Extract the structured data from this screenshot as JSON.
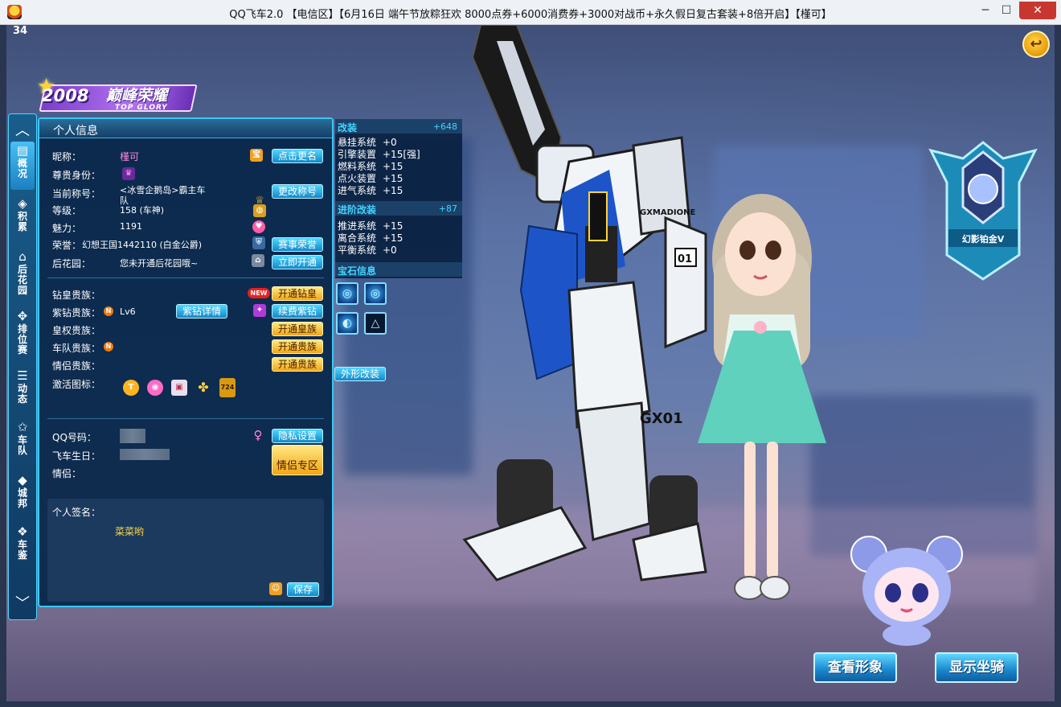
{
  "window": {
    "title": "QQ飞车2.0 【电信区】【6月16日 端午节放粽狂欢 8000点券+6000消费券+3000对战币+永久假日复古套装+8倍开启】【槿可】",
    "minimize": "─",
    "maximize": "☐",
    "close": "✕"
  },
  "hud": {
    "fps": "34",
    "back_icon": "back-arrow-icon"
  },
  "banner": {
    "year": "2008",
    "name": "巅峰荣耀",
    "sub": "TOP GLORY"
  },
  "nav": {
    "items": [
      {
        "label": "概况",
        "icon": "profile-card-icon",
        "active": true
      },
      {
        "label": "积累",
        "icon": "layers-icon",
        "active": false
      },
      {
        "label": "后花园",
        "icon": "garden-house-icon",
        "active": false
      },
      {
        "label": "排位赛",
        "icon": "ranked-wings-icon",
        "active": false
      },
      {
        "label": "动态",
        "icon": "feed-icon",
        "active": false
      },
      {
        "label": "车队",
        "icon": "team-star-icon",
        "active": false
      },
      {
        "label": "城邦",
        "icon": "city-icon",
        "active": false
      },
      {
        "label": "车鉴",
        "icon": "car-book-icon",
        "active": false
      }
    ]
  },
  "profile": {
    "panel_title": "个人信息",
    "nickname_label": "昵称：",
    "nickname": "槿可",
    "rename_button": "点击更名",
    "noble_label": "尊贵身份：",
    "title_label": "当前称号：",
    "title_value_line1": "<冰雪企鹅岛>霸主车",
    "title_value_line2": "队",
    "change_title_button": "更改称号",
    "level_label": "等级：",
    "level_value": "158 (车神)",
    "charm_label": "魅力：",
    "charm_value": "1191",
    "honor_label": "荣誉：",
    "honor_value": "幻想王国1442110 (白金公爵)",
    "honor_button": "赛事荣誉",
    "garden_label": "后花园：",
    "garden_value": "您未开通后花园哦~",
    "garden_button": "立即开通",
    "diamond_label": "钻皇贵族：",
    "diamond_new": "NEW",
    "diamond_button": "开通钻皇",
    "purple_label": "紫钻贵族：",
    "purple_level": "Lv6",
    "purple_detail_button": "紫钻详情",
    "purple_renew_button": "续费紫钻",
    "royal_label": "皇权贵族：",
    "royal_button": "开通皇族",
    "team_label": "车队贵族：",
    "team_button": "开通贵族",
    "couple_noble_label": "情侣贵族：",
    "couple_noble_button": "开通贵族",
    "active_icons_label": "激活图标：",
    "active_icon_badge": "724",
    "qq_label": "QQ号码：",
    "privacy_button": "隐私设置",
    "birthday_label": "飞车生日：",
    "couple_label": "情侣：",
    "couple_zone_button": "情侣专区",
    "signature_label": "个人签名：",
    "signature_value": "菜菜哟",
    "save_button": "保存"
  },
  "mods": {
    "refit_title": "改装",
    "refit_total": "+648",
    "refit_items": [
      {
        "name": "悬挂系统",
        "value": "+0"
      },
      {
        "name": "引擎装置",
        "value": "+15[强]"
      },
      {
        "name": "燃料系统",
        "value": "+15"
      },
      {
        "name": "点火装置",
        "value": "+15"
      },
      {
        "name": "进气系统",
        "value": "+15"
      }
    ],
    "advanced_title": "进阶改装",
    "advanced_total": "+87",
    "advanced_items": [
      {
        "name": "推进系统",
        "value": "+15"
      },
      {
        "name": "离合系统",
        "value": "+15"
      },
      {
        "name": "平衡系统",
        "value": "+0"
      }
    ],
    "gem_title": "宝石信息",
    "appearance_button": "外形改装"
  },
  "robot": {
    "label_top": "GXMADIONE",
    "label_number": "01",
    "label_leg": "GX01"
  },
  "rank": {
    "name": "幻影铂金V"
  },
  "actions": {
    "view_look": "查看形象",
    "show_mount": "显示坐骑"
  }
}
